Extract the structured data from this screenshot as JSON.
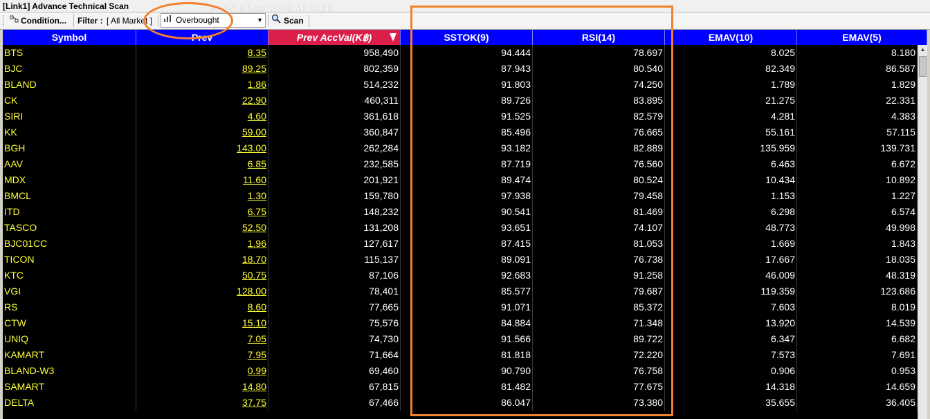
{
  "window": {
    "title": "[Link1] Advance Technical Scan",
    "watermark": "www.efinancethai.com"
  },
  "toolbar": {
    "condition_label": "Condition...",
    "filter_label": "Filter :",
    "filter_value": "[ All Market ]",
    "condition_value": "Overbought",
    "scan_label": "Scan"
  },
  "columns": [
    "Symbol",
    "Prev",
    "Prev AccVal(K฿)",
    "SSTOK(9)",
    "RSI(14)",
    "EMAV(10)",
    "EMAV(5)"
  ],
  "rows": [
    [
      "BTS",
      "8.35",
      "958,490",
      "94.444",
      "78.697",
      "8.025",
      "8.180"
    ],
    [
      "BJC",
      "89.25",
      "802,359",
      "87.943",
      "80.540",
      "82.349",
      "86.587"
    ],
    [
      "BLAND",
      "1.86",
      "514,232",
      "91.803",
      "74.250",
      "1.789",
      "1.829"
    ],
    [
      "CK",
      "22.90",
      "460,311",
      "89.726",
      "83.895",
      "21.275",
      "22.331"
    ],
    [
      "SIRI",
      "4.60",
      "361,618",
      "91.525",
      "82.579",
      "4.281",
      "4.383"
    ],
    [
      "KK",
      "59.00",
      "360,847",
      "85.496",
      "76.665",
      "55.161",
      "57.115"
    ],
    [
      "BGH",
      "143.00",
      "262,284",
      "93.182",
      "82.889",
      "135.959",
      "139.731"
    ],
    [
      "AAV",
      "6.85",
      "232,585",
      "87.719",
      "76.560",
      "6.463",
      "6.672"
    ],
    [
      "MDX",
      "11.60",
      "201,921",
      "89.474",
      "80.524",
      "10.434",
      "10.892"
    ],
    [
      "BMCL",
      "1.30",
      "159,780",
      "97.938",
      "79.458",
      "1.153",
      "1.227"
    ],
    [
      "ITD",
      "6.75",
      "148,232",
      "90.541",
      "81.469",
      "6.298",
      "6.574"
    ],
    [
      "TASCO",
      "52.50",
      "131,208",
      "93.651",
      "74.107",
      "48.773",
      "49.998"
    ],
    [
      "BJC01CC",
      "1.96",
      "127,617",
      "87.415",
      "81.053",
      "1.669",
      "1.843"
    ],
    [
      "TICON",
      "18.70",
      "115,137",
      "89.091",
      "76.738",
      "17.667",
      "18.035"
    ],
    [
      "KTC",
      "50.75",
      "87,106",
      "92.683",
      "91.258",
      "46.009",
      "48.319"
    ],
    [
      "VGI",
      "128.00",
      "78,401",
      "85.577",
      "79.687",
      "119.359",
      "123.686"
    ],
    [
      "RS",
      "8.60",
      "77,665",
      "91.071",
      "85.372",
      "7.603",
      "8.019"
    ],
    [
      "CTW",
      "15.10",
      "75,576",
      "84.884",
      "71.348",
      "13.920",
      "14.539"
    ],
    [
      "UNIQ",
      "7.05",
      "74,730",
      "91.566",
      "89.722",
      "6.347",
      "6.682"
    ],
    [
      "KAMART",
      "7.95",
      "71,664",
      "81.818",
      "72.220",
      "7.573",
      "7.691"
    ],
    [
      "BLAND-W3",
      "0.99",
      "69,460",
      "90.790",
      "76.758",
      "0.906",
      "0.953"
    ],
    [
      "SAMART",
      "14.80",
      "67,815",
      "81.482",
      "77.675",
      "14.318",
      "14.659"
    ],
    [
      "DELTA",
      "37.75",
      "67,466",
      "86.047",
      "73.380",
      "35.655",
      "36.405"
    ]
  ],
  "colors": {
    "header_bg": "#0000ff",
    "sorted_header_bg": "#dc1e4a",
    "symbol_text": "#ffff33",
    "grid_bg": "#000000",
    "highlight": "#f47f2a"
  },
  "icons": {
    "condition": "condition-icon",
    "overbought": "overbought-icon",
    "scan": "magnifier-icon",
    "sort": "sort-desc-icon"
  }
}
